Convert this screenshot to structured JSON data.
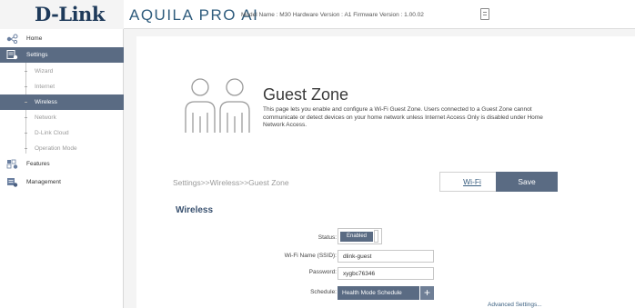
{
  "header": {
    "logo": "D-Link",
    "brand": "AQUILA PRO AI",
    "model_info": "Model Name : M30 Hardware Version : A1 Firmware Version : 1.00.02"
  },
  "sidebar": {
    "items": [
      {
        "label": "Home",
        "icon": "home-network-icon"
      },
      {
        "label": "Settings",
        "icon": "settings-icon"
      },
      {
        "label": "Features",
        "icon": "features-icon"
      },
      {
        "label": "Management",
        "icon": "management-icon"
      }
    ],
    "settings_sub": [
      {
        "label": "Wizard"
      },
      {
        "label": "Internet"
      },
      {
        "label": "Wireless"
      },
      {
        "label": "Network"
      },
      {
        "label": "D-Link Cloud"
      },
      {
        "label": "Operation Mode"
      }
    ]
  },
  "page": {
    "title": "Guest Zone",
    "description": "This page lets you enable and configure a Wi-Fi Guest Zone. Users connected to a Guest Zone cannot communicate or detect devices on your home network unless Internet Access Only is disabled under Home Network Access.",
    "breadcrumb": "Settings>>Wireless>>Guest Zone",
    "wifi_link": "Wi-Fi",
    "save_label": "Save",
    "section_title": "Wireless"
  },
  "form": {
    "status_label": "Status:",
    "status_value": "Enabled",
    "ssid_label": "Wi-Fi Name (SSID):",
    "ssid_value": "dlink-guest",
    "password_label": "Password:",
    "password_value": "xygbc76346",
    "schedule_label": "Schedule:",
    "schedule_value": "Health Mode Schedule",
    "schedule_add": "+",
    "advanced_link": "Advanced Settings..."
  },
  "colors": {
    "accent": "#5a6b83",
    "brand": "#2f5c7d",
    "logo": "#1e3a5a"
  }
}
